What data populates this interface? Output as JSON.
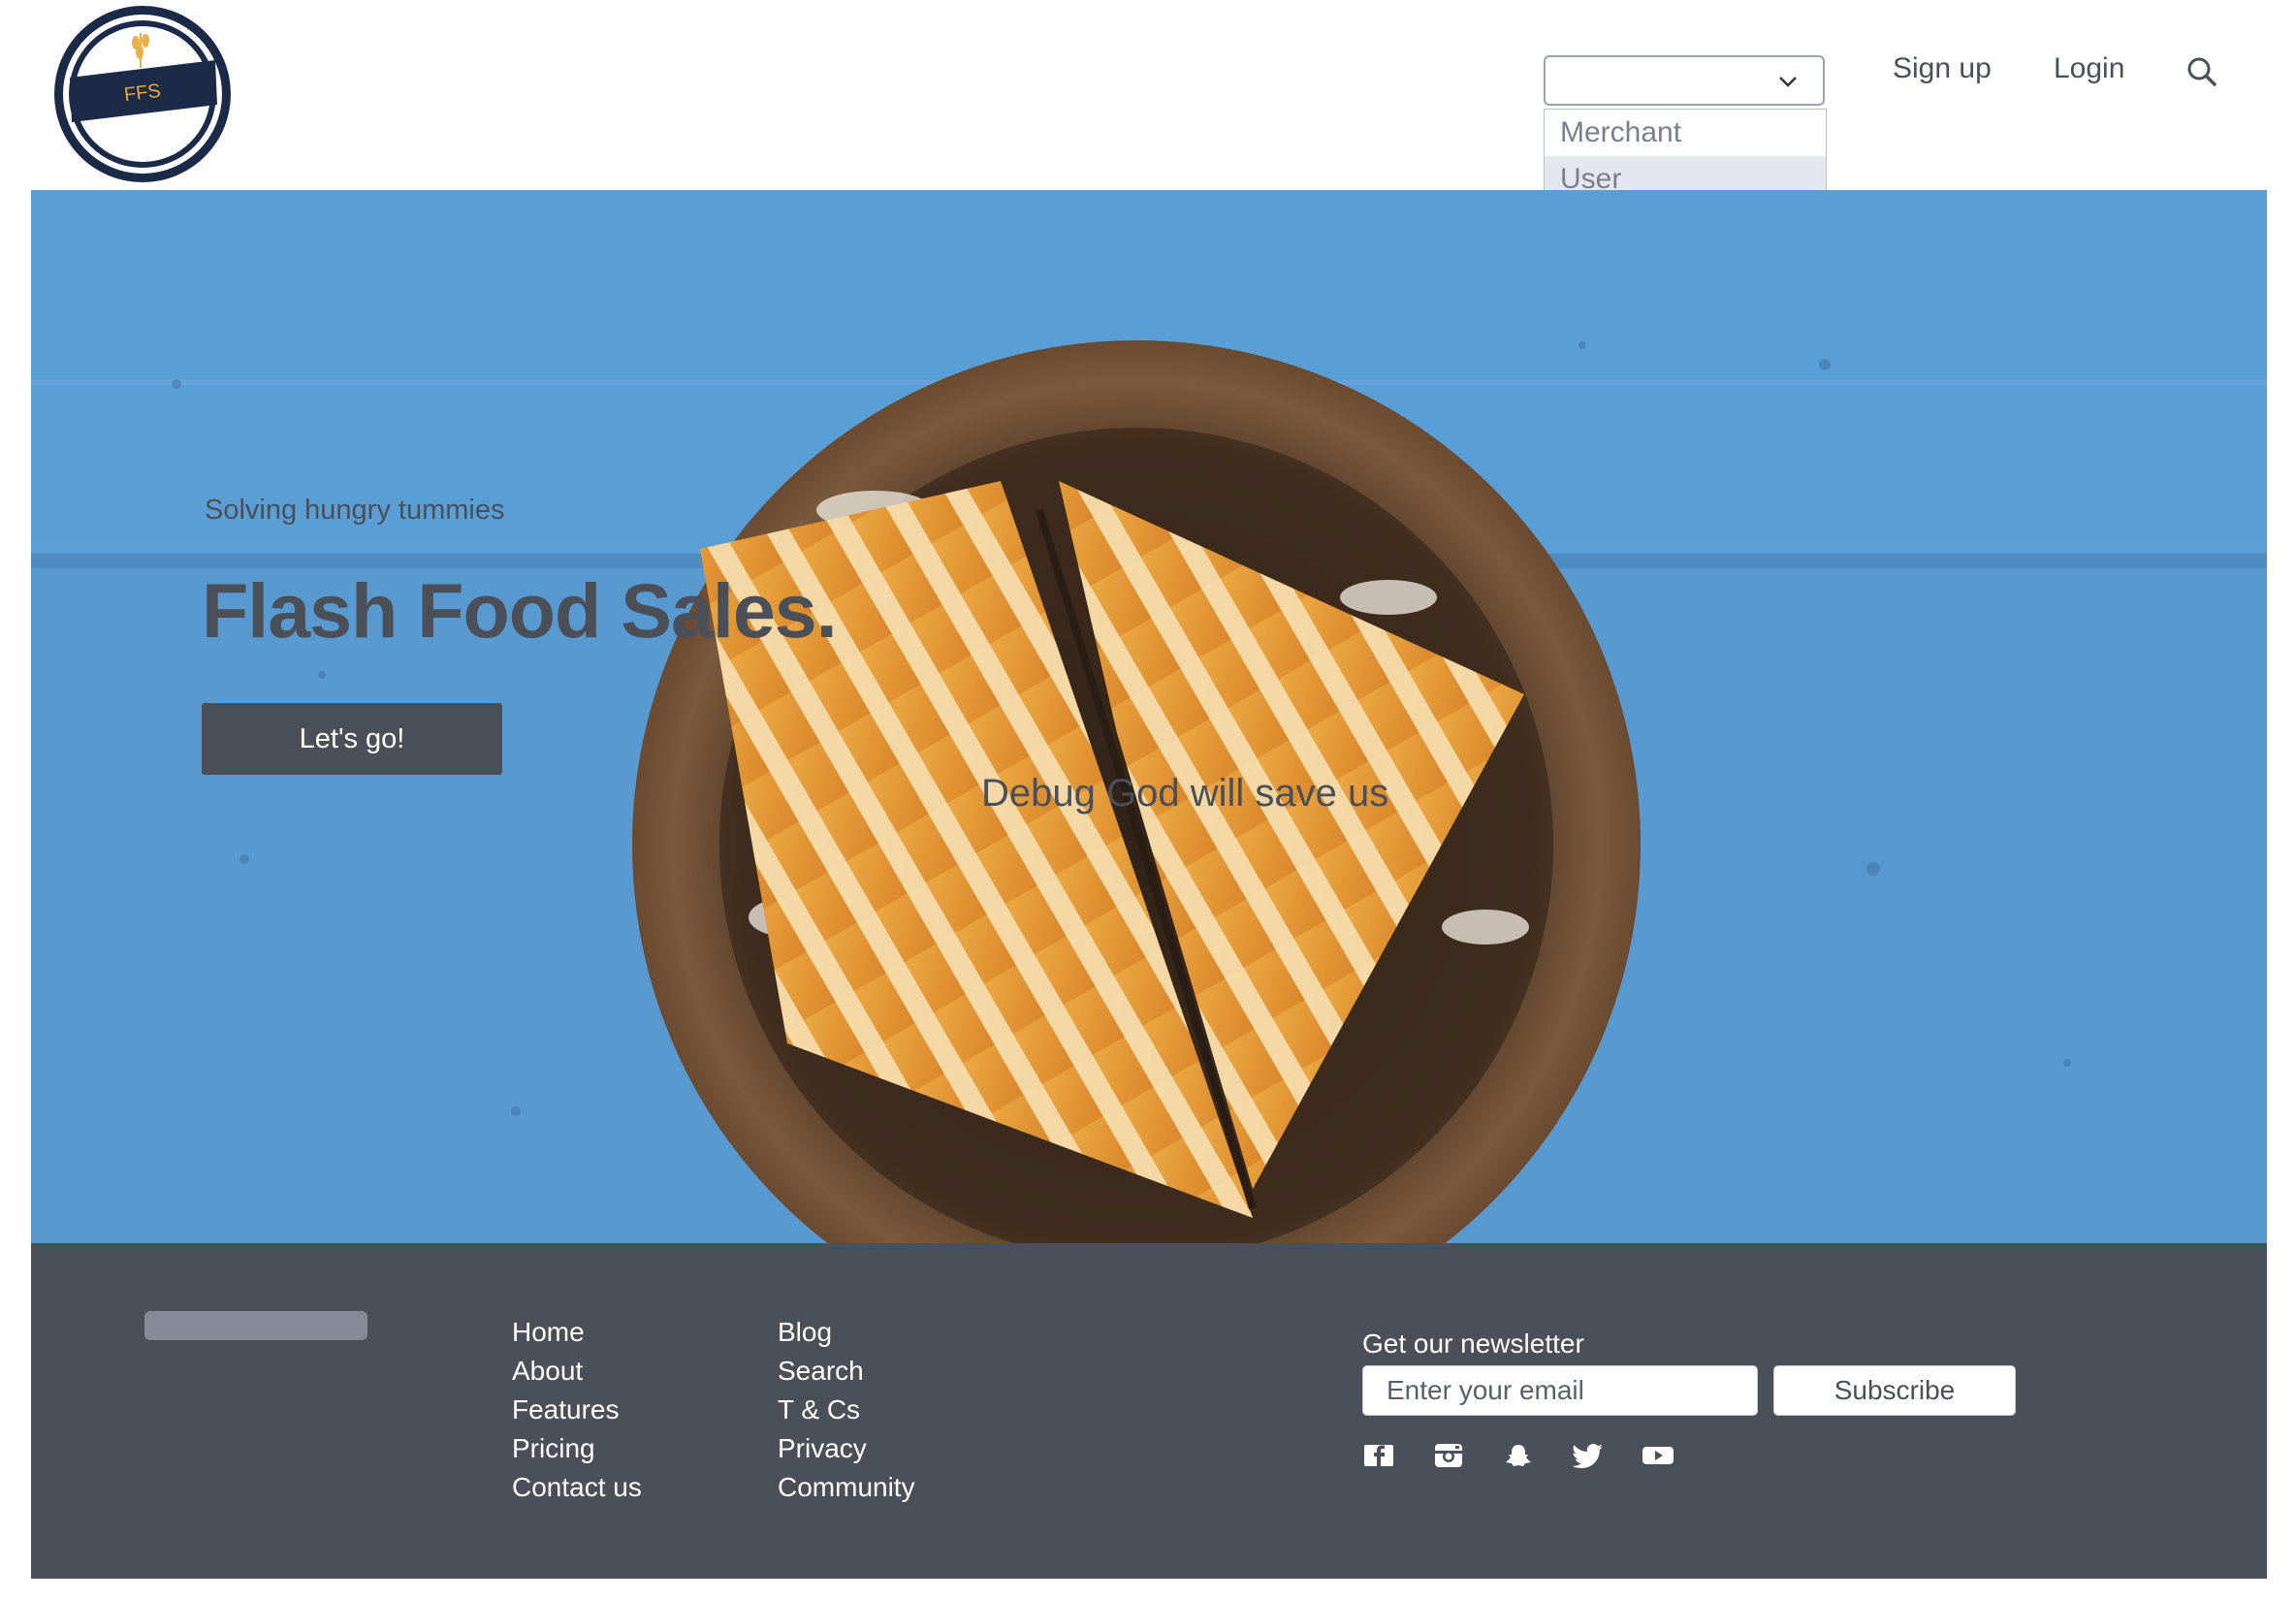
{
  "header": {
    "logo_text": "FFS",
    "role_select": {
      "value": "",
      "options": [
        "Merchant",
        "User"
      ],
      "highlighted": "User"
    },
    "nav": {
      "signup": "Sign up",
      "login": "Login"
    },
    "icons": [
      "search-icon",
      "chevron-down-icon"
    ]
  },
  "hero": {
    "subtitle": "Solving hungry tummies",
    "title": "Flash Food Sales.",
    "cta": "Let's go!",
    "caption": "Debug God will save us"
  },
  "footer": {
    "col1": [
      "Home",
      "About",
      "Features",
      "Pricing",
      "Contact us"
    ],
    "col2": [
      "Blog",
      "Search",
      "T & Cs",
      "Privacy",
      "Community"
    ],
    "newsletter": {
      "label": "Get our newsletter",
      "placeholder": "Enter your email",
      "button": "Subscribe"
    },
    "social": [
      "facebook-icon",
      "instagram-icon",
      "snapchat-icon",
      "twitter-icon",
      "youtube-icon"
    ]
  },
  "colors": {
    "text": "#4a4f58",
    "footer_bg": "#4a4f58",
    "hero_bg": "#5b9fd4"
  }
}
